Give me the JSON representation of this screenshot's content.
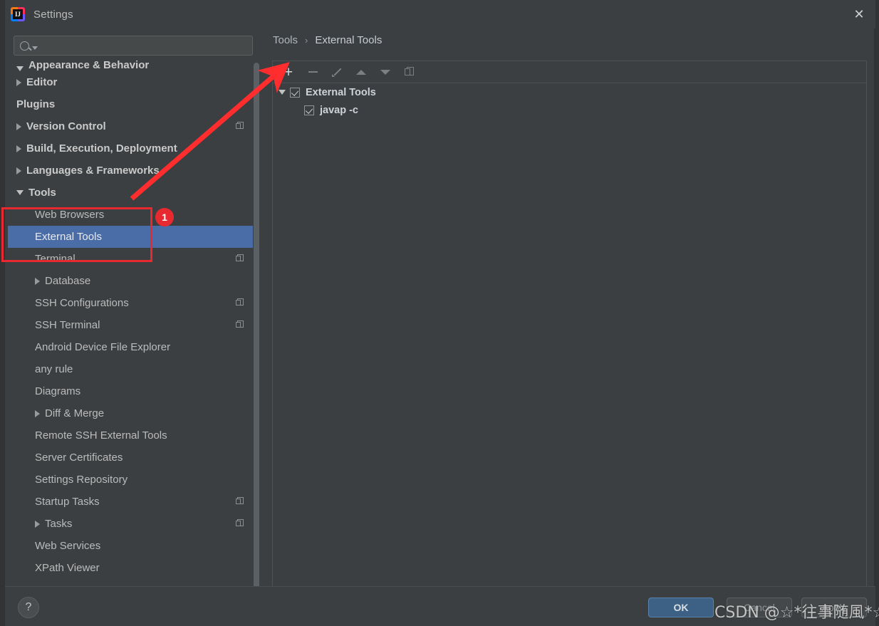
{
  "window": {
    "title": "Settings",
    "app_icon": "intellij-idea-icon",
    "close_label": "✕"
  },
  "search": {
    "value": "",
    "placeholder": "",
    "icon": "search-icon",
    "caret_icon": "chevron-down-icon"
  },
  "sidebar": {
    "items": [
      {
        "label": "Appearance & Behavior",
        "arrow": "down",
        "level": 0,
        "bold": true,
        "clipped": true,
        "copy": false,
        "selected": false
      },
      {
        "label": "Editor",
        "arrow": "right",
        "level": 0,
        "bold": true,
        "copy": false,
        "selected": false
      },
      {
        "label": "Plugins",
        "arrow": "none",
        "level": 0,
        "bold": true,
        "copy": false,
        "selected": false
      },
      {
        "label": "Version Control",
        "arrow": "right",
        "level": 0,
        "bold": true,
        "copy": true,
        "selected": false
      },
      {
        "label": "Build, Execution, Deployment",
        "arrow": "right",
        "level": 0,
        "bold": true,
        "copy": false,
        "selected": false
      },
      {
        "label": "Languages & Frameworks",
        "arrow": "right",
        "level": 0,
        "bold": true,
        "copy": false,
        "selected": false
      },
      {
        "label": "Tools",
        "arrow": "down",
        "level": 0,
        "bold": true,
        "copy": false,
        "selected": false
      },
      {
        "label": "Web Browsers",
        "arrow": "none",
        "level": 1,
        "bold": false,
        "copy": false,
        "selected": false
      },
      {
        "label": "External Tools",
        "arrow": "none",
        "level": 1,
        "bold": false,
        "copy": false,
        "selected": true
      },
      {
        "label": "Terminal",
        "arrow": "none",
        "level": 1,
        "bold": false,
        "copy": true,
        "selected": false
      },
      {
        "label": "Database",
        "arrow": "right",
        "level": 1,
        "bold": false,
        "copy": false,
        "selected": false
      },
      {
        "label": "SSH Configurations",
        "arrow": "none",
        "level": 1,
        "bold": false,
        "copy": true,
        "selected": false
      },
      {
        "label": "SSH Terminal",
        "arrow": "none",
        "level": 1,
        "bold": false,
        "copy": true,
        "selected": false
      },
      {
        "label": "Android Device File Explorer",
        "arrow": "none",
        "level": 1,
        "bold": false,
        "copy": false,
        "selected": false
      },
      {
        "label": "any rule",
        "arrow": "none",
        "level": 1,
        "bold": false,
        "copy": false,
        "selected": false
      },
      {
        "label": "Diagrams",
        "arrow": "none",
        "level": 1,
        "bold": false,
        "copy": false,
        "selected": false
      },
      {
        "label": "Diff & Merge",
        "arrow": "right",
        "level": 1,
        "bold": false,
        "copy": false,
        "selected": false
      },
      {
        "label": "Remote SSH External Tools",
        "arrow": "none",
        "level": 1,
        "bold": false,
        "copy": false,
        "selected": false
      },
      {
        "label": "Server Certificates",
        "arrow": "none",
        "level": 1,
        "bold": false,
        "copy": false,
        "selected": false
      },
      {
        "label": "Settings Repository",
        "arrow": "none",
        "level": 1,
        "bold": false,
        "copy": false,
        "selected": false
      },
      {
        "label": "Startup Tasks",
        "arrow": "none",
        "level": 1,
        "bold": false,
        "copy": true,
        "selected": false
      },
      {
        "label": "Tasks",
        "arrow": "right",
        "level": 1,
        "bold": false,
        "copy": true,
        "selected": false
      },
      {
        "label": "Web Services",
        "arrow": "none",
        "level": 1,
        "bold": false,
        "copy": false,
        "selected": false
      },
      {
        "label": "XPath Viewer",
        "arrow": "none",
        "level": 1,
        "bold": false,
        "copy": false,
        "selected": false
      }
    ]
  },
  "content": {
    "breadcrumb": [
      {
        "label": "Tools"
      },
      {
        "label": "External Tools"
      }
    ],
    "breadcrumb_separator": "›",
    "toolbar": [
      {
        "name": "add-button",
        "icon": "plus-icon",
        "enabled": true
      },
      {
        "name": "remove-button",
        "icon": "minus-icon",
        "enabled": false
      },
      {
        "name": "edit-button",
        "icon": "pencil-icon",
        "enabled": false
      },
      {
        "name": "move-up-button",
        "icon": "arrow-up-icon",
        "enabled": false
      },
      {
        "name": "move-down-button",
        "icon": "arrow-down-icon",
        "enabled": false
      },
      {
        "name": "copy-button",
        "icon": "copy-icon",
        "enabled": false
      }
    ],
    "tree": {
      "group_label": "External Tools",
      "group_checked": true,
      "group_expanded": true,
      "children": [
        {
          "label": "javap -c",
          "checked": true
        }
      ]
    }
  },
  "footer": {
    "help_label": "?",
    "ok_label": "OK",
    "cancel_label": "Cancel",
    "apply_label": "Apply"
  },
  "annotations": {
    "badge_1": "1",
    "accent_color": "#e8292f",
    "selection_color": "#4a6da7"
  },
  "watermark": {
    "text": "CSDN @☆*往事随風*☆"
  }
}
